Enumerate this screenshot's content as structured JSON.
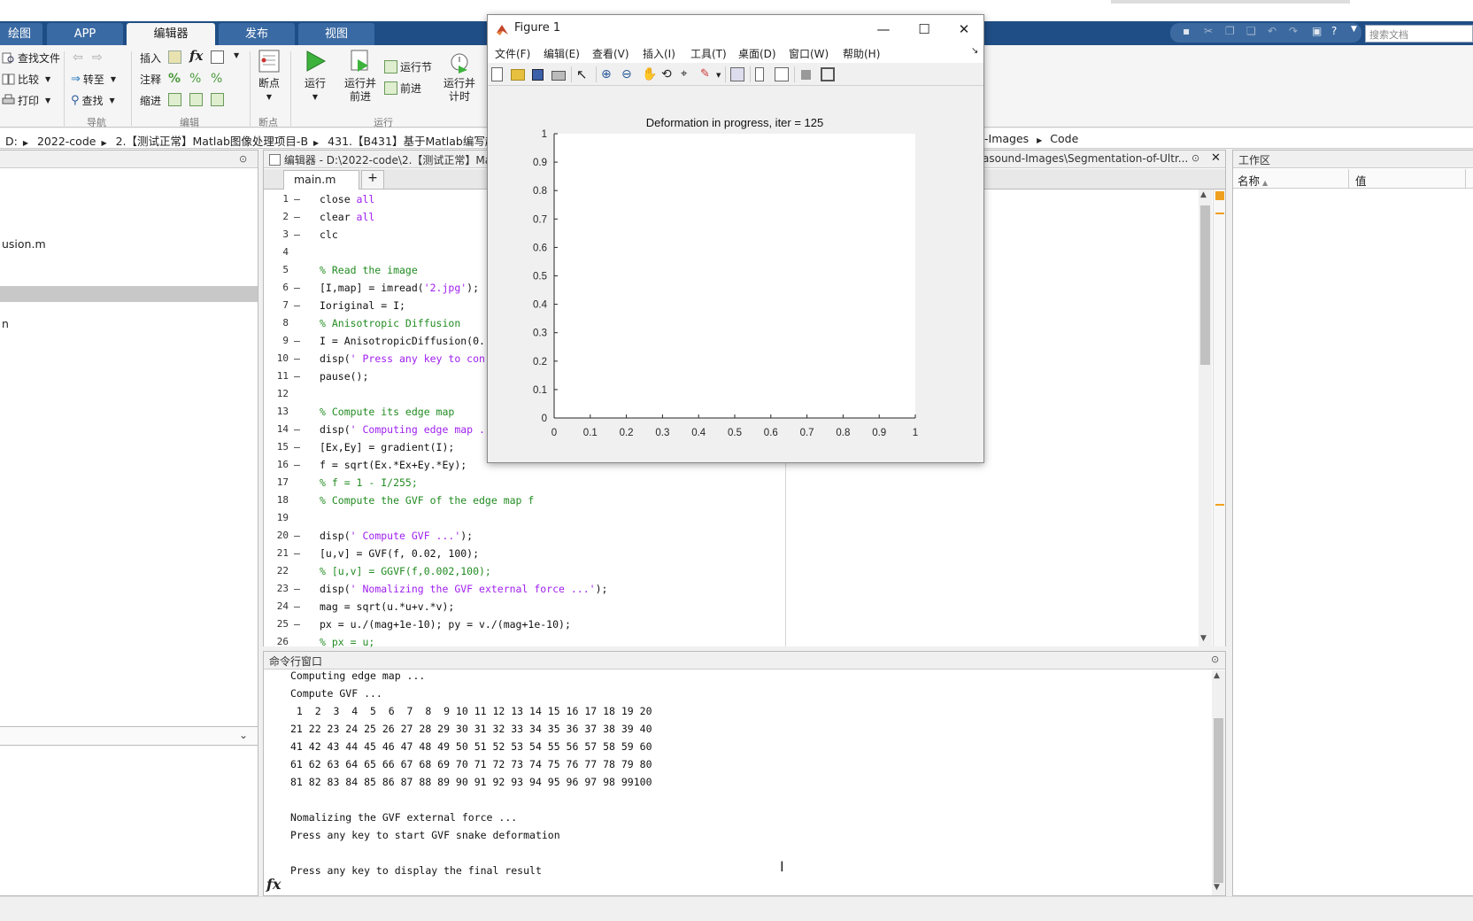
{
  "ribbon": {
    "tabs": [
      "绘图",
      "APP",
      "编辑器",
      "发布",
      "视图"
    ],
    "active_tab": "编辑器",
    "file_group": {
      "find_files": "查找文件",
      "compare": "比较",
      "print": "打印"
    },
    "nav_group": {
      "goto": "转至",
      "find": "查找",
      "label": "导航"
    },
    "edit_group": {
      "insert": "插入",
      "comment": "注释",
      "indent": "缩进",
      "label": "编辑",
      "fx": "fx"
    },
    "breakpoint_group": {
      "breakpoints": "断点",
      "label": "断点"
    },
    "run_group": {
      "run": "运行",
      "run_advance_1": "运行并",
      "run_advance_2": "前进",
      "run_section": "运行节",
      "advance": "前进",
      "run_time_1": "运行并",
      "run_time_2": "计时",
      "label": "运行"
    },
    "search_placeholder": "搜索文档"
  },
  "address_bar": {
    "left_crumbs": [
      "D:",
      "2022-code",
      "2.【测试正常】Matlab图像处理项目-B",
      "431.【B431】基于Matlab编写超声图"
    ],
    "right_crumbs": [
      "-Images",
      "Code"
    ]
  },
  "file_browser": {
    "items": [
      "usion.m",
      "",
      "n"
    ],
    "selected_index": 1
  },
  "editor": {
    "title_left": "编辑器 - D:\\2022-code\\2.【测试正常】Ma",
    "title_right": "asound-Images\\Segmentation-of-Ultr...",
    "tab": "main.m",
    "tab_add": "+",
    "lines": [
      {
        "n": "1",
        "exec": true,
        "parts": [
          {
            "t": "close ",
            "c": ""
          },
          {
            "t": "all",
            "c": "st"
          }
        ]
      },
      {
        "n": "2",
        "exec": true,
        "parts": [
          {
            "t": "clear ",
            "c": ""
          },
          {
            "t": "all",
            "c": "st"
          }
        ]
      },
      {
        "n": "3",
        "exec": true,
        "parts": [
          {
            "t": "clc",
            "c": ""
          }
        ]
      },
      {
        "n": "4",
        "exec": false,
        "parts": []
      },
      {
        "n": "5",
        "exec": false,
        "parts": [
          {
            "t": "% Read the image",
            "c": "cm"
          }
        ]
      },
      {
        "n": "6",
        "exec": true,
        "parts": [
          {
            "t": "[I,map] = imread(",
            "c": ""
          },
          {
            "t": "'2.jpg'",
            "c": "st"
          },
          {
            "t": ");",
            "c": ""
          }
        ]
      },
      {
        "n": "7",
        "exec": true,
        "parts": [
          {
            "t": "Ioriginal = I;",
            "c": ""
          }
        ]
      },
      {
        "n": "8",
        "exec": false,
        "parts": [
          {
            "t": "% Anisotropic Diffusion",
            "c": "cm"
          }
        ]
      },
      {
        "n": "9",
        "exec": true,
        "parts": [
          {
            "t": "I = AnisotropicDiffusion(0.",
            "c": ""
          }
        ]
      },
      {
        "n": "10",
        "exec": true,
        "parts": [
          {
            "t": "disp(",
            "c": ""
          },
          {
            "t": "' Press any key to con",
            "c": "st"
          }
        ]
      },
      {
        "n": "11",
        "exec": true,
        "parts": [
          {
            "t": "pause();",
            "c": ""
          }
        ]
      },
      {
        "n": "12",
        "exec": false,
        "parts": []
      },
      {
        "n": "13",
        "exec": false,
        "parts": [
          {
            "t": "% Compute its edge map",
            "c": "cm"
          }
        ]
      },
      {
        "n": "14",
        "exec": true,
        "parts": [
          {
            "t": "disp(",
            "c": ""
          },
          {
            "t": "' Computing edge map .",
            "c": "st"
          }
        ]
      },
      {
        "n": "15",
        "exec": true,
        "parts": [
          {
            "t": "[Ex,Ey] = gradient(I);",
            "c": ""
          }
        ]
      },
      {
        "n": "16",
        "exec": true,
        "parts": [
          {
            "t": "f = sqrt(Ex.*Ex+Ey.*Ey);",
            "c": ""
          }
        ]
      },
      {
        "n": "17",
        "exec": false,
        "parts": [
          {
            "t": "% f = 1 - I/255;",
            "c": "cm"
          }
        ]
      },
      {
        "n": "18",
        "exec": false,
        "parts": [
          {
            "t": "% Compute the GVF of the edge map f",
            "c": "cm"
          }
        ]
      },
      {
        "n": "19",
        "exec": false,
        "parts": []
      },
      {
        "n": "20",
        "exec": true,
        "parts": [
          {
            "t": "disp(",
            "c": ""
          },
          {
            "t": "' Compute GVF ...'",
            "c": "st"
          },
          {
            "t": ");",
            "c": ""
          }
        ]
      },
      {
        "n": "21",
        "exec": true,
        "parts": [
          {
            "t": "[u,v] = GVF(f, 0.02, 100);",
            "c": ""
          }
        ]
      },
      {
        "n": "22",
        "exec": false,
        "parts": [
          {
            "t": "% [u,v] = GGVF(f,0.002,100);",
            "c": "cm"
          }
        ]
      },
      {
        "n": "23",
        "exec": true,
        "parts": [
          {
            "t": "disp(",
            "c": ""
          },
          {
            "t": "' Nomalizing the GVF external force ...'",
            "c": "st"
          },
          {
            "t": ");",
            "c": ""
          }
        ]
      },
      {
        "n": "24",
        "exec": true,
        "parts": [
          {
            "t": "mag = sqrt(u.*u+v.*v);",
            "c": ""
          }
        ]
      },
      {
        "n": "25",
        "exec": true,
        "parts": [
          {
            "t": "px = u./(mag+1e-10); py = v./(mag+1e-10);",
            "c": ""
          }
        ]
      },
      {
        "n": "26",
        "exec": false,
        "parts": [
          {
            "t": "% px = u;",
            "c": "cm"
          }
        ]
      }
    ]
  },
  "command_window": {
    "title": "命令行窗口",
    "prompt_icon": "fx",
    "lines": [
      "Computing edge map ...",
      "Compute GVF ...",
      " 1  2  3  4  5  6  7  8  9 10 11 12 13 14 15 16 17 18 19 20",
      "21 22 23 24 25 26 27 28 29 30 31 32 33 34 35 36 37 38 39 40",
      "41 42 43 44 45 46 47 48 49 50 51 52 53 54 55 56 57 58 59 60",
      "61 62 63 64 65 66 67 68 69 70 71 72 73 74 75 76 77 78 79 80",
      "81 82 83 84 85 86 87 88 89 90 91 92 93 94 95 96 97 98 99100",
      "",
      "Nomalizing the GVF external force ...",
      "Press any key to start GVF snake deformation",
      "",
      "Press any key to display the final result"
    ]
  },
  "workspace": {
    "title": "工作区",
    "col_name": "名称",
    "col_value": "值",
    "sort_arrow": "▲"
  },
  "figure": {
    "title": "Figure 1",
    "menus": [
      "文件(F)",
      "编辑(E)",
      "查看(V)",
      "插入(I)",
      "工具(T)",
      "桌面(D)",
      "窗口(W)",
      "帮助(H)"
    ],
    "menu_arrow": "↘",
    "controls": {
      "minimize": "—",
      "maximize": "☐",
      "close": "✕"
    }
  },
  "chart_data": {
    "type": "line",
    "title": "Deformation in progress,  iter = 125",
    "xlabel": "",
    "ylabel": "",
    "xlim": [
      0,
      1
    ],
    "ylim": [
      0,
      1
    ],
    "xticks": [
      "0",
      "0.1",
      "0.2",
      "0.3",
      "0.4",
      "0.5",
      "0.6",
      "0.7",
      "0.8",
      "0.9",
      "1"
    ],
    "yticks": [
      "0",
      "0.1",
      "0.2",
      "0.3",
      "0.4",
      "0.5",
      "0.6",
      "0.7",
      "0.8",
      "0.9",
      "1"
    ],
    "grid": false,
    "series": []
  }
}
